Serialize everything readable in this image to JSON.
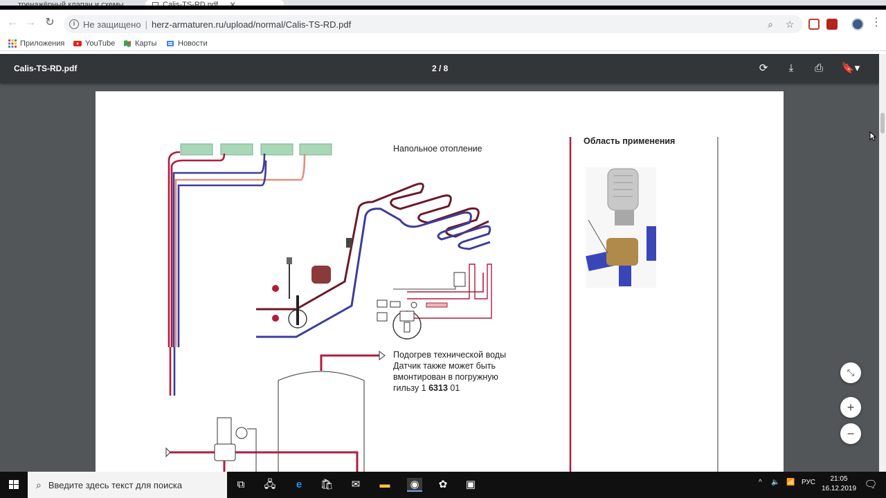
{
  "browser": {
    "tabs": [
      {
        "title": "тренажёрный клапан и схемы...",
        "active": false
      },
      {
        "title": "Calis-TS-RD.pdf",
        "active": true
      }
    ],
    "address": {
      "security_state": "Не защищено",
      "url": "herz-armaturen.ru/upload/normal/Calis-TS-RD.pdf"
    },
    "bookmarks": [
      {
        "label": "Приложения",
        "icon": "apps-grid-icon"
      },
      {
        "label": "YouTube",
        "icon": "youtube-icon"
      },
      {
        "label": "Карты",
        "icon": "maps-icon"
      },
      {
        "label": "Новости",
        "icon": "news-icon"
      }
    ]
  },
  "pdf": {
    "title": "Calis-TS-RD.pdf",
    "page_indicator": "2 / 8",
    "actions": [
      "rotate-icon",
      "download-icon",
      "print-icon",
      "bookmark-icon"
    ]
  },
  "document": {
    "floor_heating_label": "Напольное отопление",
    "application_title": "Область применения",
    "hot_water": {
      "line1": "Подогрев технической воды",
      "line2": "Датчик  также  может  быть",
      "line3": "вмонтирован  в погружную",
      "line4_prefix": "гильзу  1 ",
      "line4_bold": "6313",
      "line4_suffix": " 01"
    }
  },
  "zoom_controls": [
    "fit-page-icon",
    "zoom-in-icon",
    "zoom-out-icon"
  ],
  "taskbar": {
    "search_placeholder": "Введите здесь текст для поиска",
    "language": "РУС",
    "time": "21:05",
    "date": "16.12.2019"
  },
  "colors": {
    "pipe_red": "#b01c3c",
    "pipe_blue": "#3c3c9c",
    "radiator_green": "#a8d8b8",
    "pdf_toolbar": "#323639",
    "viewer_bg": "#525659"
  }
}
